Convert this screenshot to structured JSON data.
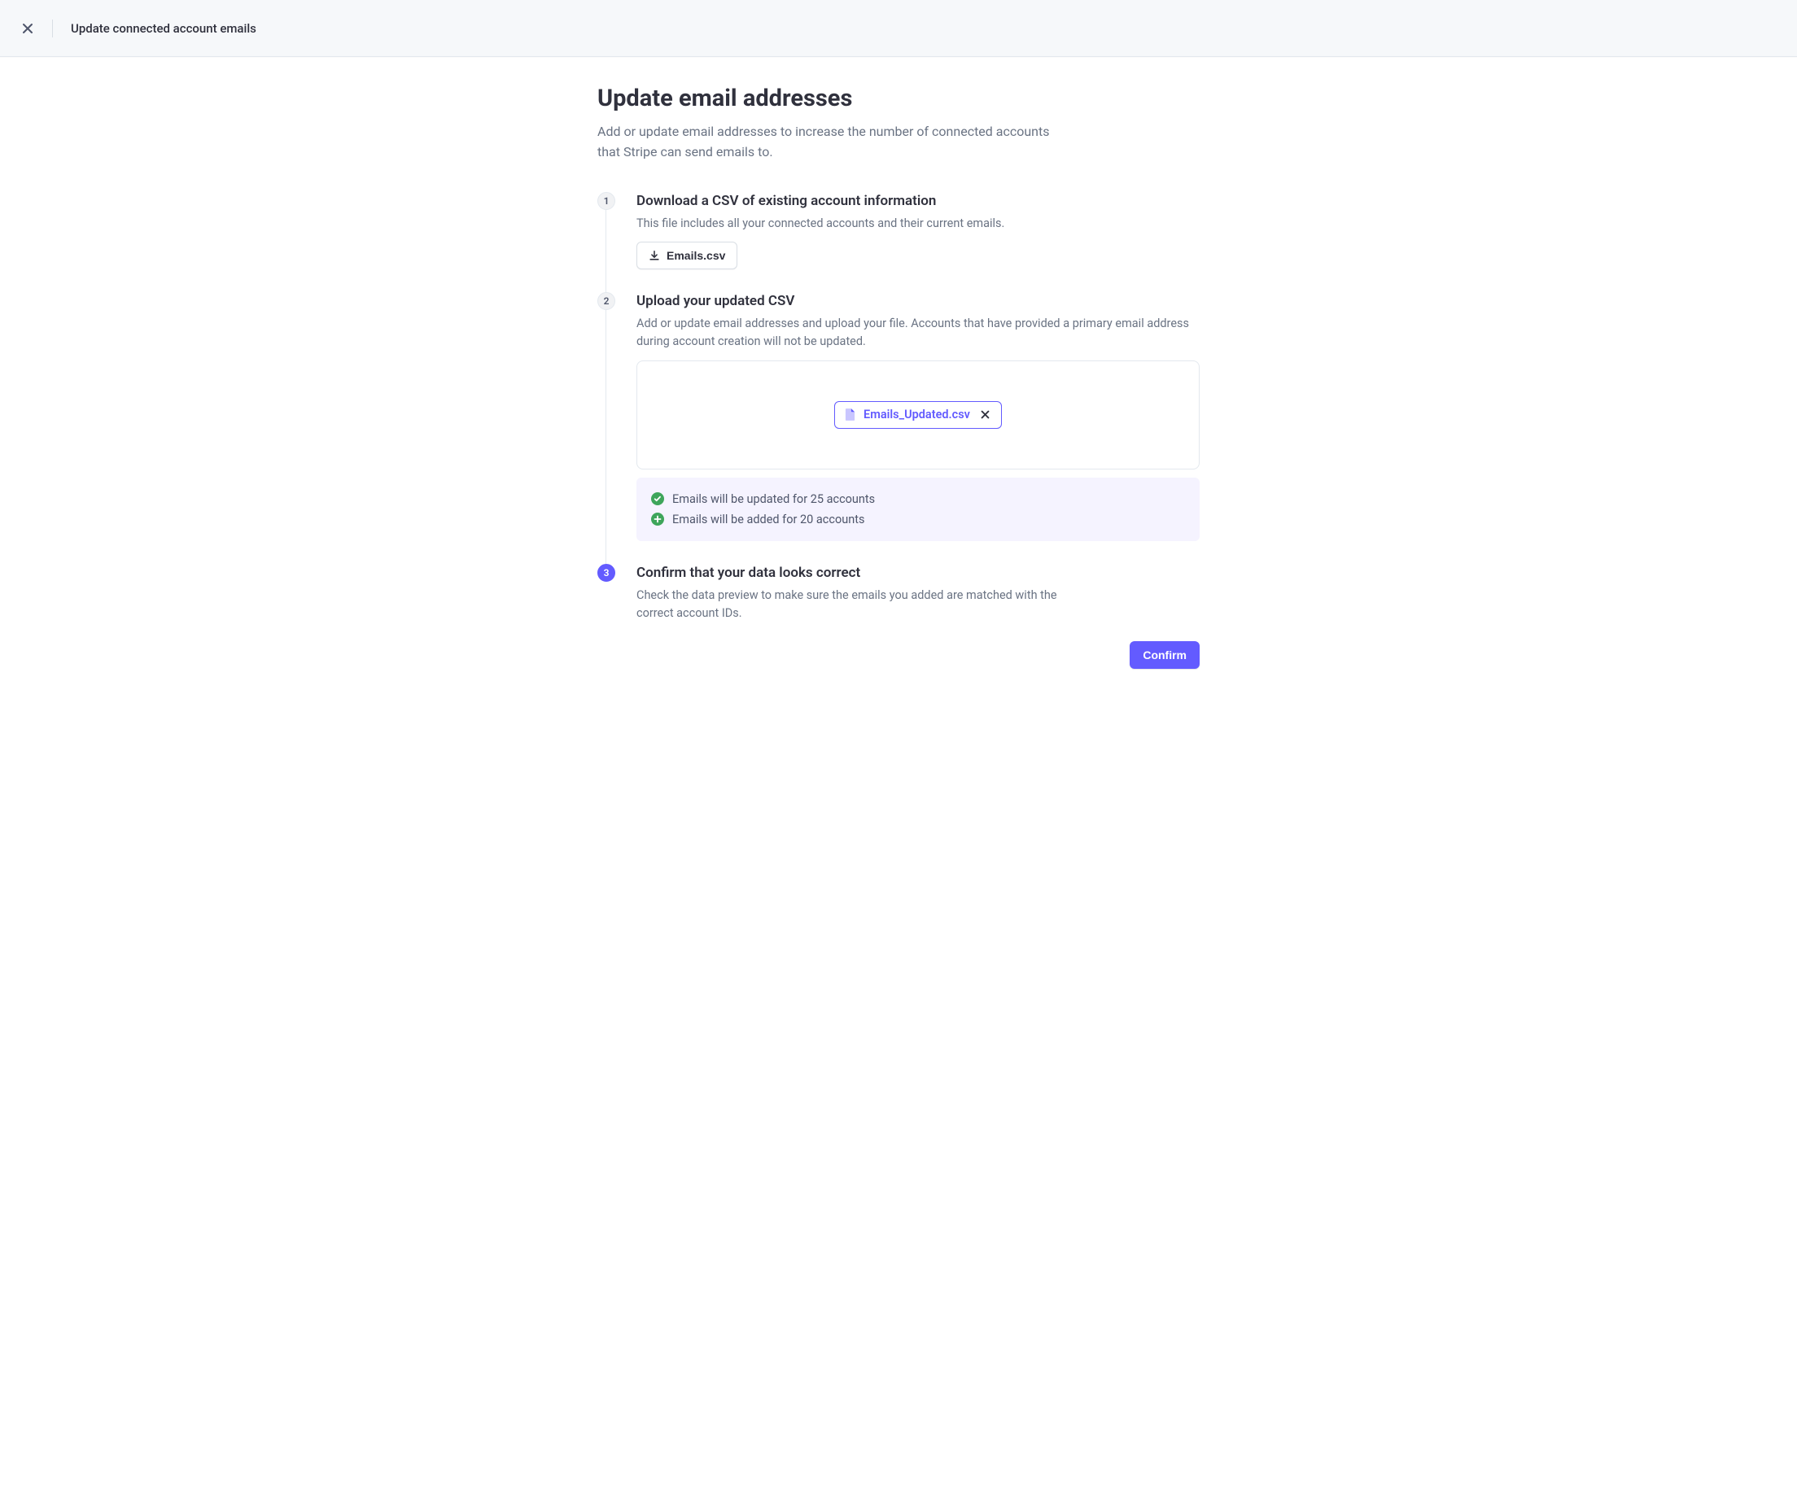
{
  "topbar": {
    "title": "Update connected account emails"
  },
  "page": {
    "title": "Update email addresses",
    "subtitle": "Add or update email addresses to increase the number of connected accounts that Stripe can send emails to."
  },
  "steps": {
    "s1": {
      "num": "1",
      "title": "Download a CSV of existing account information",
      "desc": "This file includes all your connected accounts and their current emails.",
      "download_label": "Emails.csv"
    },
    "s2": {
      "num": "2",
      "title": "Upload your updated CSV",
      "desc": "Add or update email addresses and upload your file. Accounts that have provided a primary email address during account creation will not be updated.",
      "uploaded_file": "Emails_Updated.csv",
      "summary_updated": "Emails will be updated for 25 accounts",
      "summary_added": "Emails will be added for 20 accounts"
    },
    "s3": {
      "num": "3",
      "title": "Confirm that your data looks correct",
      "desc": "Check the data preview to make sure the emails you added are matched with the correct account IDs.",
      "confirm_label": "Confirm"
    }
  },
  "colors": {
    "accent": "#635bff",
    "success": "#3ea55b"
  }
}
